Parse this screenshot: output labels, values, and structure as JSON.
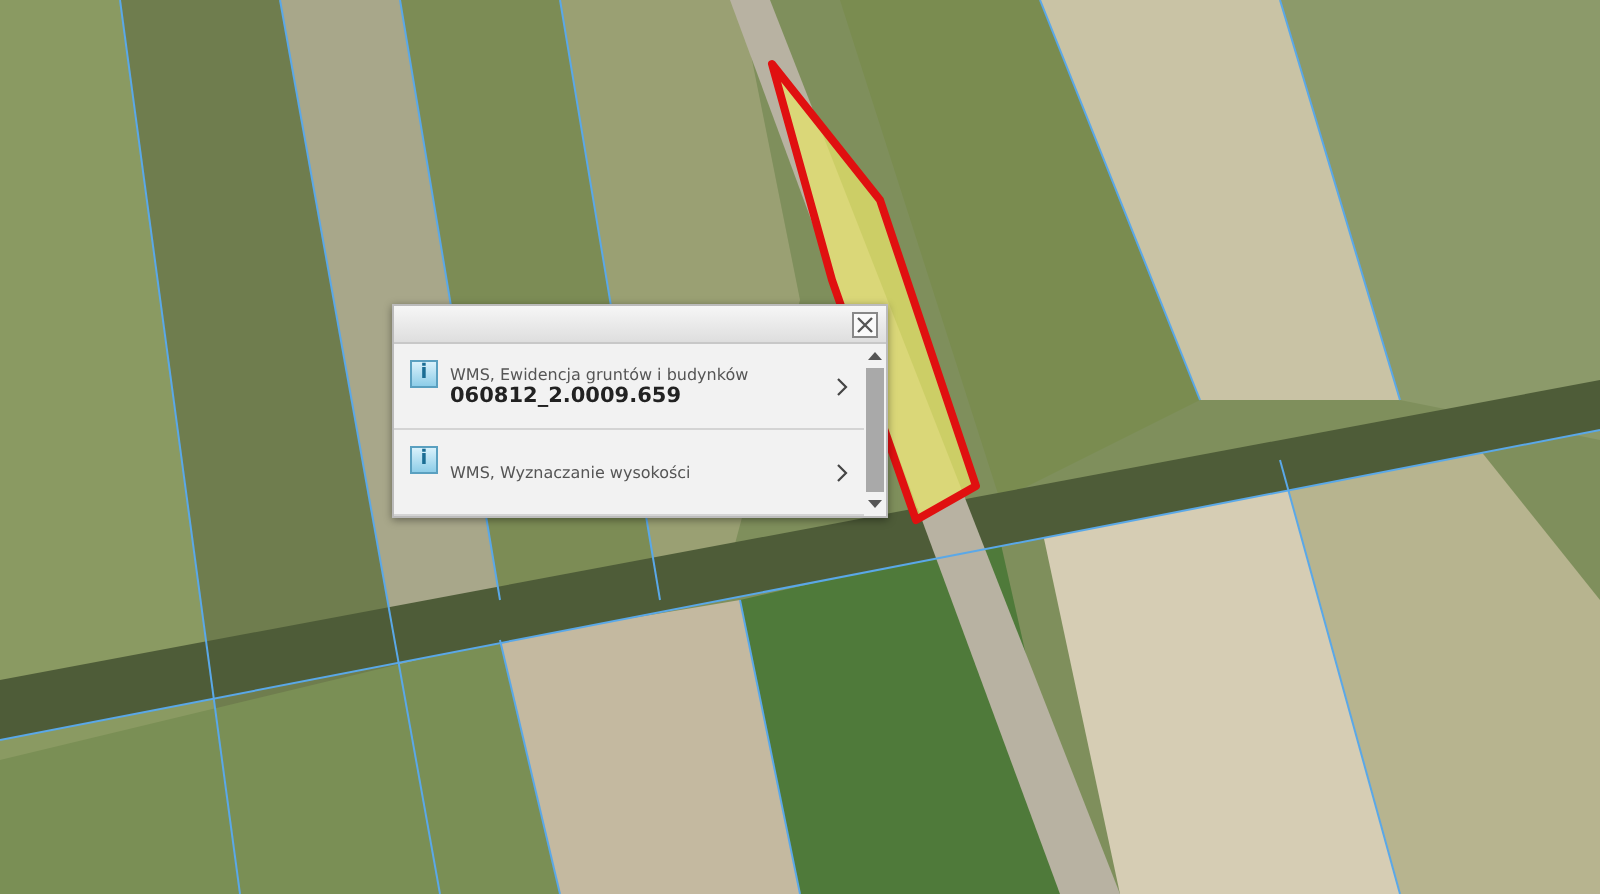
{
  "map": {
    "parcel_highlighted": true
  },
  "popup": {
    "results": [
      {
        "icon_glyph": "i",
        "source": "WMS, Ewidencja gruntów i budynków",
        "value": "060812_2.0009.659"
      },
      {
        "icon_glyph": "i",
        "source": "WMS, Wyznaczanie wysokości"
      }
    ]
  }
}
